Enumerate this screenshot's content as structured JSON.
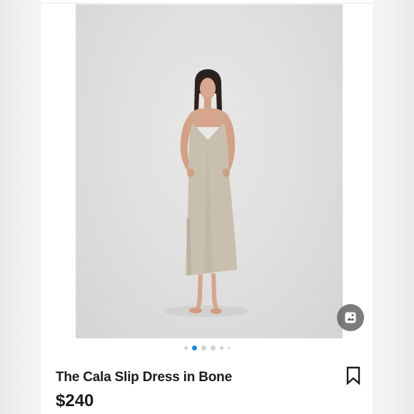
{
  "listing": {
    "title": "The Cala Slip Dress in Bone",
    "price": "$240"
  },
  "carousel": {
    "photo_count": 6,
    "active_index": 1
  },
  "icons": {
    "image_viewer": "image-icon",
    "save": "bookmark-icon"
  },
  "colors": {
    "active_dot": "#1e88e5",
    "inactive_dot": "#d2d2d2",
    "text": "#1c1c1c",
    "dress": "#c9bfae"
  }
}
